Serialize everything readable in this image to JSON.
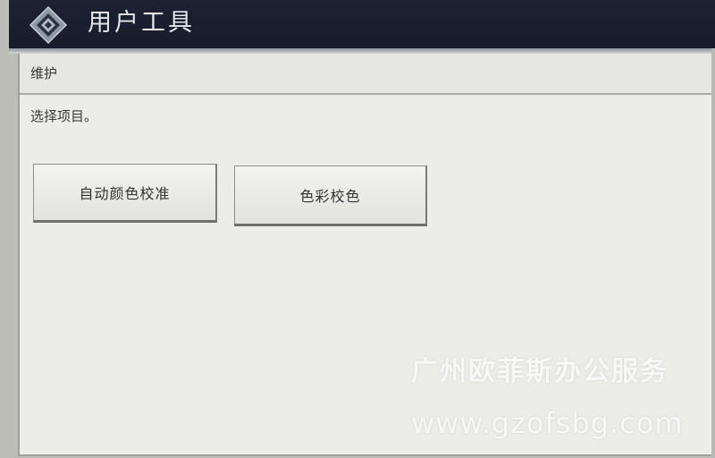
{
  "window": {
    "title": "用户工具",
    "icon": "diamond-logo-icon"
  },
  "section": {
    "label": "维护"
  },
  "main": {
    "instruction": "选择项目。",
    "buttons": [
      {
        "label": "自动颜色校准"
      },
      {
        "label": "色彩校色"
      }
    ]
  },
  "watermark": {
    "line1": "广州欧菲斯办公服务",
    "line2": "www.gzofsbg.com"
  },
  "colors": {
    "titlebar": "#1d2233",
    "panel": "#ecece9",
    "button": "#efefec"
  }
}
